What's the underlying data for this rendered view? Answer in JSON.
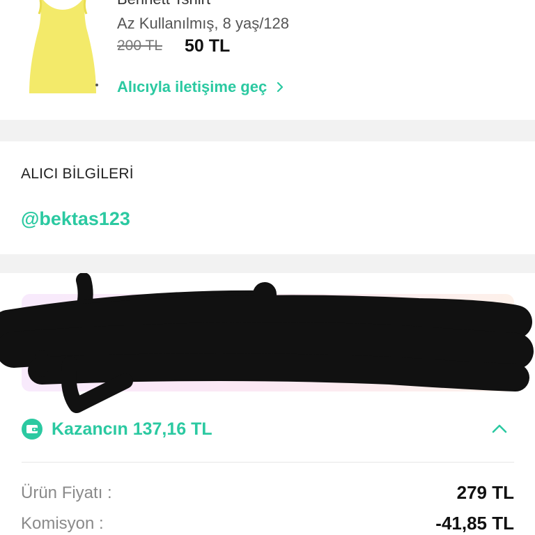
{
  "product": {
    "title": "Bennett Tshirt",
    "condition": "Az Kullanılmış, 8 yaş/128",
    "old_price": "200 TL",
    "price": "50 TL",
    "contact_link": "Alıcıyla iletişime geç",
    "image_icon": "yellow-tank-top"
  },
  "buyer": {
    "heading": "ALICI BİLGİLERİ",
    "username": "@bektas123"
  },
  "earnings": {
    "label": "Kazancın 137,16 TL",
    "rows": [
      {
        "label": "Ürün Fiyatı :",
        "value": "279 TL"
      },
      {
        "label": "Komisyon :",
        "value": "-41,85 TL"
      }
    ]
  },
  "colors": {
    "accent": "#2bc9a1",
    "separator": "#f2f2f2"
  }
}
